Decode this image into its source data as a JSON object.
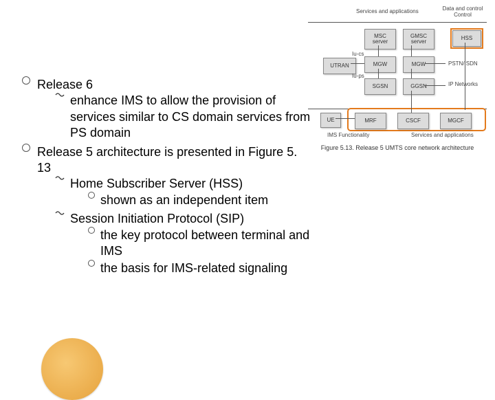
{
  "slide": {
    "items": [
      {
        "text": "Release 6",
        "children": [
          {
            "text": "enhance IMS to allow the provision of services similar to CS domain services from PS domain"
          }
        ]
      },
      {
        "text": "Release 5 architecture is presented in Figure 5. 13",
        "children": [
          {
            "text": "Home Subscriber Server (HSS)",
            "children": [
              {
                "text": "shown as an independent item"
              }
            ]
          },
          {
            "text": "Session Initiation Protocol (SIP)",
            "children": [
              {
                "text": "the key protocol between terminal and IMS"
              },
              {
                "text": "the basis for IMS-related signaling"
              }
            ]
          }
        ]
      }
    ]
  },
  "figure": {
    "caption": "Figure 5.13. Release 5 UMTS core network architecture",
    "top_labels": {
      "services": "Services and applications",
      "control": "Data and control Control"
    },
    "iface": {
      "iucs": "Iu-cs",
      "iups": "Iu-ps"
    },
    "bottom_labels": {
      "ims": "IMS Functionality",
      "serv": "Services and applications"
    },
    "row2": {
      "msc": "MSC server",
      "gmsc": "GMSC server",
      "hss": "HSS"
    },
    "row3": {
      "utran": "UTRAN",
      "mgw1": "MGW",
      "mgw2": "MGW",
      "pstn": "PSTN/ISDN"
    },
    "row4": {
      "sgsn": "SGSN",
      "ggsn": "GGSN",
      "ip": "IP Networks"
    },
    "row5": {
      "ue": "UE",
      "mrf": "MRF",
      "cscf": "CSCF",
      "mgcf": "MGCF"
    }
  }
}
